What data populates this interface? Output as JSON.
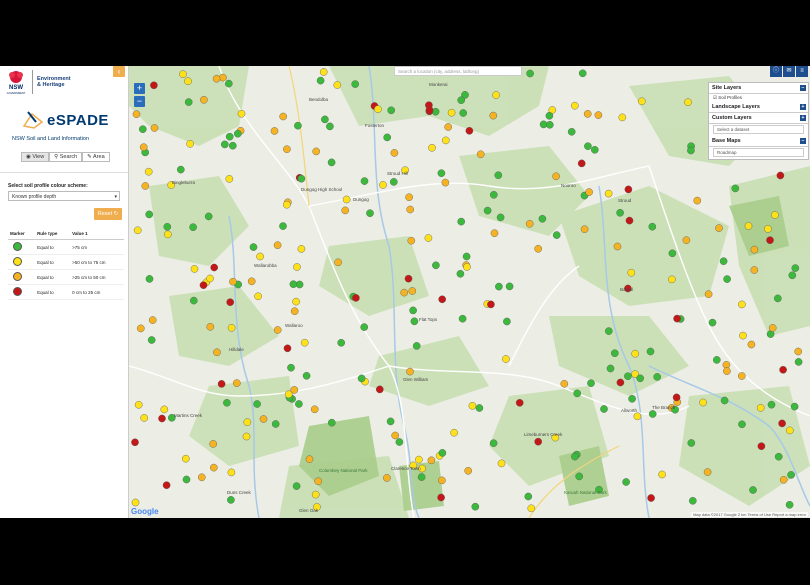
{
  "sidebar": {
    "org_line1": "NSW",
    "org_line2": "GOVERNMENT",
    "dept_line1": "Environment",
    "dept_line2": "& Heritage",
    "app_name": "eSPADE",
    "app_subtitle": "NSW Soil and Land Information",
    "tabs": [
      {
        "label": "View",
        "icon": "eye-icon"
      },
      {
        "label": "Search",
        "icon": "search-icon"
      },
      {
        "label": "Area",
        "icon": "area-icon"
      }
    ],
    "scheme_label": "Select soil profile colour scheme:",
    "scheme_value": "Known profile depth",
    "reset_label": "Reset",
    "legend": {
      "headers": [
        "Marker",
        "Rule type",
        "Value 1"
      ],
      "rows": [
        {
          "color": "#3cb93c",
          "rule": "Equal to",
          "value": ">75 cm"
        },
        {
          "color": "#ffe11a",
          "rule": "Equal to",
          "value": ">50 cm to 75 cm"
        },
        {
          "color": "#f5b324",
          "rule": "Equal to",
          "value": ">25 cm to 50 cm"
        },
        {
          "color": "#c41818",
          "rule": "Equal to",
          "value": "0 cm to 25 cm"
        }
      ]
    }
  },
  "map": {
    "search_placeholder": "Search a location (city, address, lat/long)",
    "zoom_in": "+",
    "zoom_out": "−",
    "layers": {
      "site_layers": "Site Layers",
      "soil_profiles": "Soil Profiles",
      "landscape_layers": "Landscape Layers",
      "custom_layers": "Custom Layers",
      "custom_placeholder": "Select a dataset",
      "base_maps": "Base Maps",
      "base_value": "Roadmap"
    },
    "places": [
      "Bendolba",
      "Fosterton",
      "Monkerai",
      "Bingleburra",
      "Dungog High School",
      "Dungog",
      "Stroud Hill",
      "Stroud",
      "Booral",
      "Flat Tops",
      "Wallarobba",
      "Wallaroo",
      "Hilldale",
      "Martins Creek",
      "Glen William",
      "Allworth",
      "The Branch",
      "Limeburners Creek",
      "Clarence Town",
      "Columbey National Park",
      "Karuah National Park",
      "Duns Creek",
      "Glen Oak",
      "Nooroo"
    ],
    "attribution": "Map data ©2017 Google   2 km   Terms of Use   Report a map error",
    "google": "Google",
    "colors": {
      "green": "#3cb93c",
      "yellow": "#ffe11a",
      "orange": "#f5b324",
      "red": "#c41818"
    }
  }
}
